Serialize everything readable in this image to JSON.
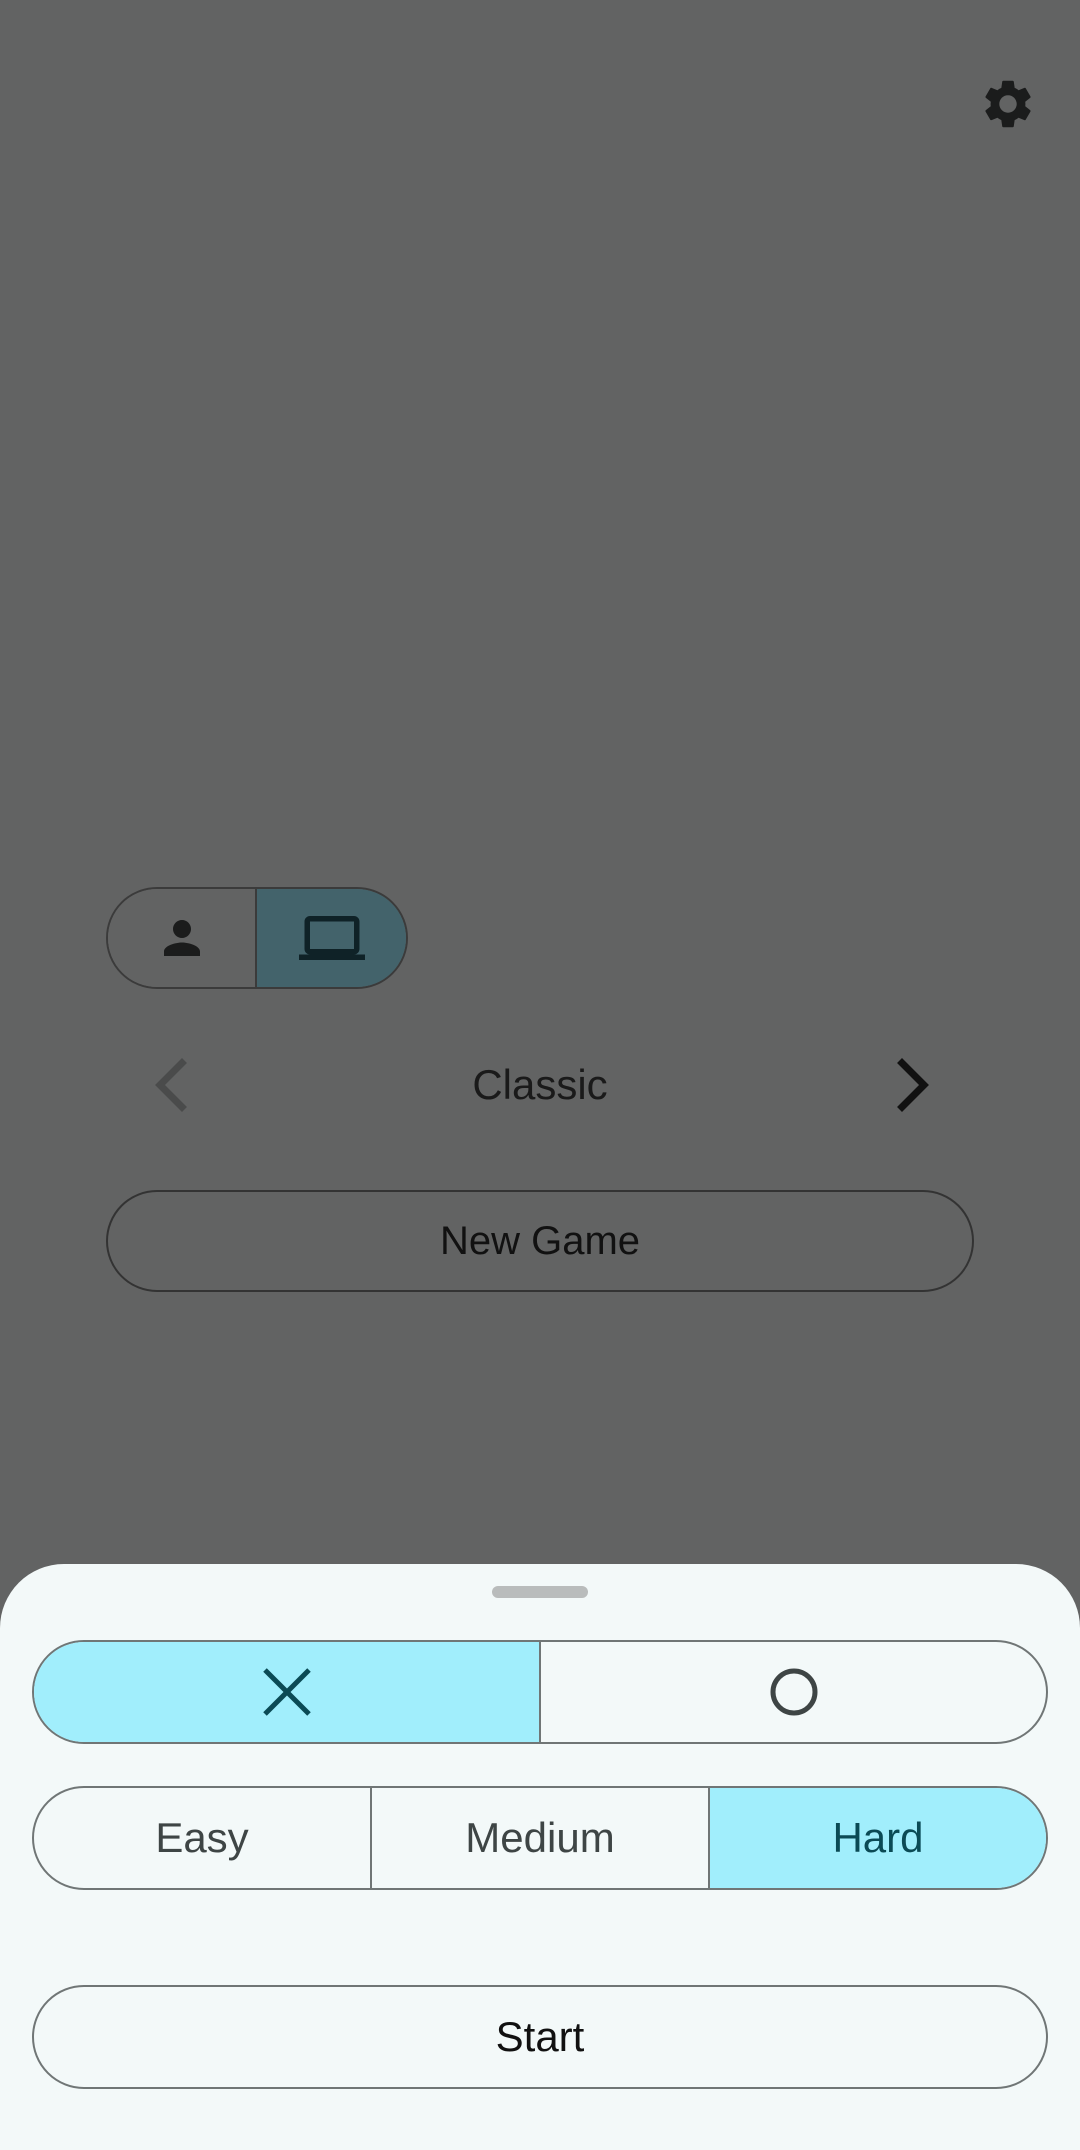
{
  "colors": {
    "backdrop": "#626363",
    "sheet": "#f3f9f9",
    "selected": "#a1eefc",
    "selected_text": "#0b4a55",
    "computer_toggle": "#43636b"
  },
  "top_bar": {
    "settings_icon": "gear-icon"
  },
  "player_toggle": {
    "options": [
      {
        "icon": "person-icon",
        "selected": false
      },
      {
        "icon": "laptop-icon",
        "selected": true
      }
    ]
  },
  "mode_selector": {
    "prev_icon": "chevron-left-icon",
    "next_icon": "chevron-right-icon",
    "label": "Classic"
  },
  "new_game_label": "New Game",
  "sheet": {
    "symbols": [
      {
        "icon": "x-icon",
        "selected": true
      },
      {
        "icon": "o-icon",
        "selected": false
      }
    ],
    "difficulty": {
      "options": [
        "Easy",
        "Medium",
        "Hard"
      ],
      "selected": "Hard"
    },
    "start_label": "Start"
  }
}
